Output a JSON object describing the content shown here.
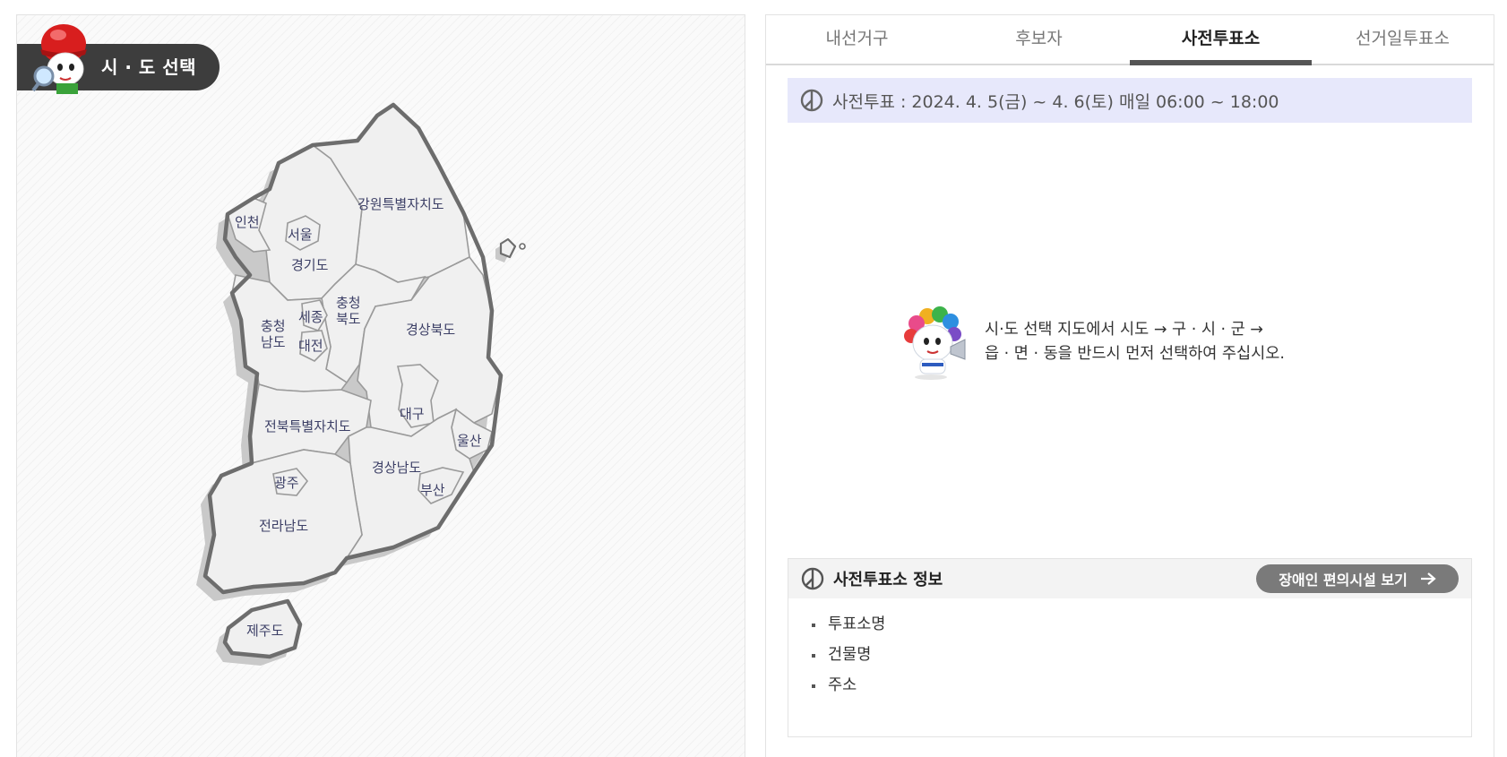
{
  "map_panel": {
    "header_title": "시 · 도 선택",
    "regions": [
      {
        "id": "incheon",
        "label": "인천"
      },
      {
        "id": "seoul",
        "label": "서울"
      },
      {
        "id": "gyeonggi",
        "label": "경기도"
      },
      {
        "id": "gangwon",
        "label": "강원특별자치도"
      },
      {
        "id": "chungnam",
        "label_lines": [
          "충청",
          "남도"
        ]
      },
      {
        "id": "sejong",
        "label": "세종"
      },
      {
        "id": "chungbuk",
        "label_lines": [
          "충청",
          "북도"
        ]
      },
      {
        "id": "daejeon",
        "label": "대전"
      },
      {
        "id": "gyeongbuk",
        "label": "경상북도"
      },
      {
        "id": "daegu",
        "label": "대구"
      },
      {
        "id": "jeonbuk",
        "label": "전북특별자치도"
      },
      {
        "id": "ulsan",
        "label": "울산"
      },
      {
        "id": "gyeongnam",
        "label": "경상남도"
      },
      {
        "id": "busan",
        "label": "부산"
      },
      {
        "id": "gwangju",
        "label": "광주"
      },
      {
        "id": "jeonnam",
        "label": "전라남도"
      },
      {
        "id": "jeju",
        "label": "제주도"
      }
    ]
  },
  "tabs": [
    {
      "label": "내선거구",
      "active": false
    },
    {
      "label": "후보자",
      "active": false
    },
    {
      "label": "사전투표소",
      "active": true
    },
    {
      "label": "선거일투표소",
      "active": false
    }
  ],
  "early_vote": {
    "schedule": "사전투표 : 2024. 4. 5(금) ~ 4. 6(토) 매일 06:00 ~ 18:00"
  },
  "guide": {
    "line1": "시·도 선택 지도에서 시도 → 구 · 시 · 군 →",
    "line2": "읍 · 면 · 동을 반드시 먼저 선택하여 주십시오."
  },
  "info": {
    "title": "사전투표소 정보",
    "accessibility_button": "장애인 편의시설 보기",
    "items": [
      "투표소명",
      "건물명",
      "주소"
    ]
  },
  "colors": {
    "banner_bg": "#e7e8fb",
    "header_bg": "#3d3d3d",
    "active_tab_underline": "#555555",
    "region_label": "#3c3f66"
  },
  "icons": {
    "ballot": "ballot-symbol-icon",
    "arrow": "arrow-right-icon"
  }
}
